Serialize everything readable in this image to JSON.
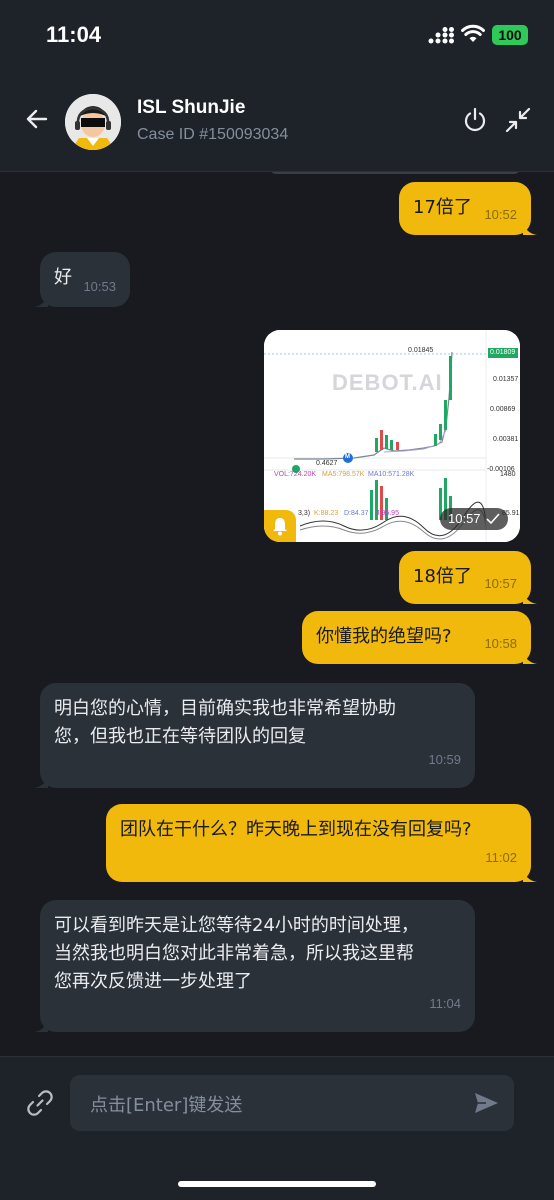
{
  "status_bar": {
    "time": "11:04",
    "battery": "100"
  },
  "header": {
    "name": "ISL ShunJie",
    "case_id": "Case ID #150093034"
  },
  "messages": [
    {
      "dir": "out",
      "text": "17倍了",
      "time": "10:52"
    },
    {
      "dir": "in",
      "text": "好",
      "time": "10:53"
    },
    {
      "dir": "out",
      "type": "image",
      "time": "10:57",
      "watermark": "DEBOT.AI",
      "chart_labels": {
        "p1": "0.01845",
        "p2": "0.01809",
        "p3": "0.01357",
        "p4": "0.00869",
        "p5": "0.00381",
        "p6": "-0.00106",
        "low": "0.4627",
        "marker": "M",
        "vol": "VOL:724.20K",
        "ma5": "MA5:798.57K",
        "ma10": "MA10:571.28K",
        "kdj_k": "K:88.23",
        "kdj_d": "D:84.37",
        "kdj_j": "J:95.95",
        "left_tag": "3,3)",
        "right_tag1": "1480",
        "right_tag2": "85.91"
      }
    },
    {
      "dir": "out",
      "text": "18倍了",
      "time": "10:57"
    },
    {
      "dir": "out",
      "text": "你懂我的绝望吗?",
      "time": "10:58"
    },
    {
      "dir": "in",
      "lines": [
        "明白您的心情，目前确实我也非常希望协助",
        "您，但我也正在等待团队的回复"
      ],
      "time": "10:59"
    },
    {
      "dir": "out",
      "text": "团队在干什么？昨天晚上到现在没有回复吗?",
      "time": "11:02"
    },
    {
      "dir": "in",
      "lines": [
        "可以看到昨天是让您等待24小时的时间处理，",
        "当然我也明白您对此非常着急，所以我这里帮",
        "您再次反馈进一步处理了"
      ],
      "time": "11:04"
    }
  ],
  "composer": {
    "placeholder": "点击[Enter]键发送"
  },
  "colors": {
    "accent": "#f0b90b",
    "bg": "#181a20",
    "bubble_in": "#2b3139"
  },
  "icons": [
    "back-arrow-icon",
    "power-icon",
    "minimize-icon",
    "link-icon",
    "send-icon",
    "bell-icon",
    "check-icon"
  ]
}
